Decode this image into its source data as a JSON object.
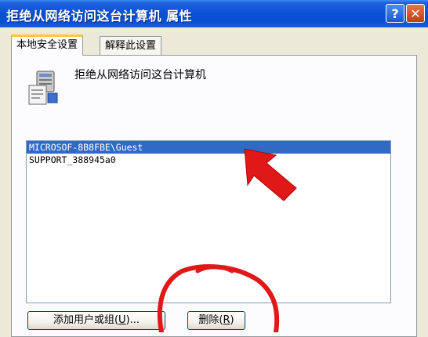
{
  "window": {
    "title": "拒绝从网络访问这台计算机 属性",
    "help_button": "?",
    "close_button": "✕"
  },
  "tabs": [
    {
      "label": "本地安全设置",
      "active": true
    },
    {
      "label": "解释此设置",
      "active": false
    }
  ],
  "policy": {
    "name": "拒绝从网络访问这台计算机",
    "icon": "security-policy-icon"
  },
  "list": {
    "items": [
      {
        "text": "MICROSOF-8B8FBE\\Guest",
        "selected": true
      },
      {
        "text": "SUPPORT_388945a0",
        "selected": false
      }
    ]
  },
  "buttons": {
    "add": {
      "label": "添加用户或组",
      "hotkey": "U",
      "suffix": "..."
    },
    "remove": {
      "label": "删除",
      "hotkey": "R"
    }
  },
  "colors": {
    "selection": "#316ac5",
    "annotation_red": "#e01818"
  }
}
